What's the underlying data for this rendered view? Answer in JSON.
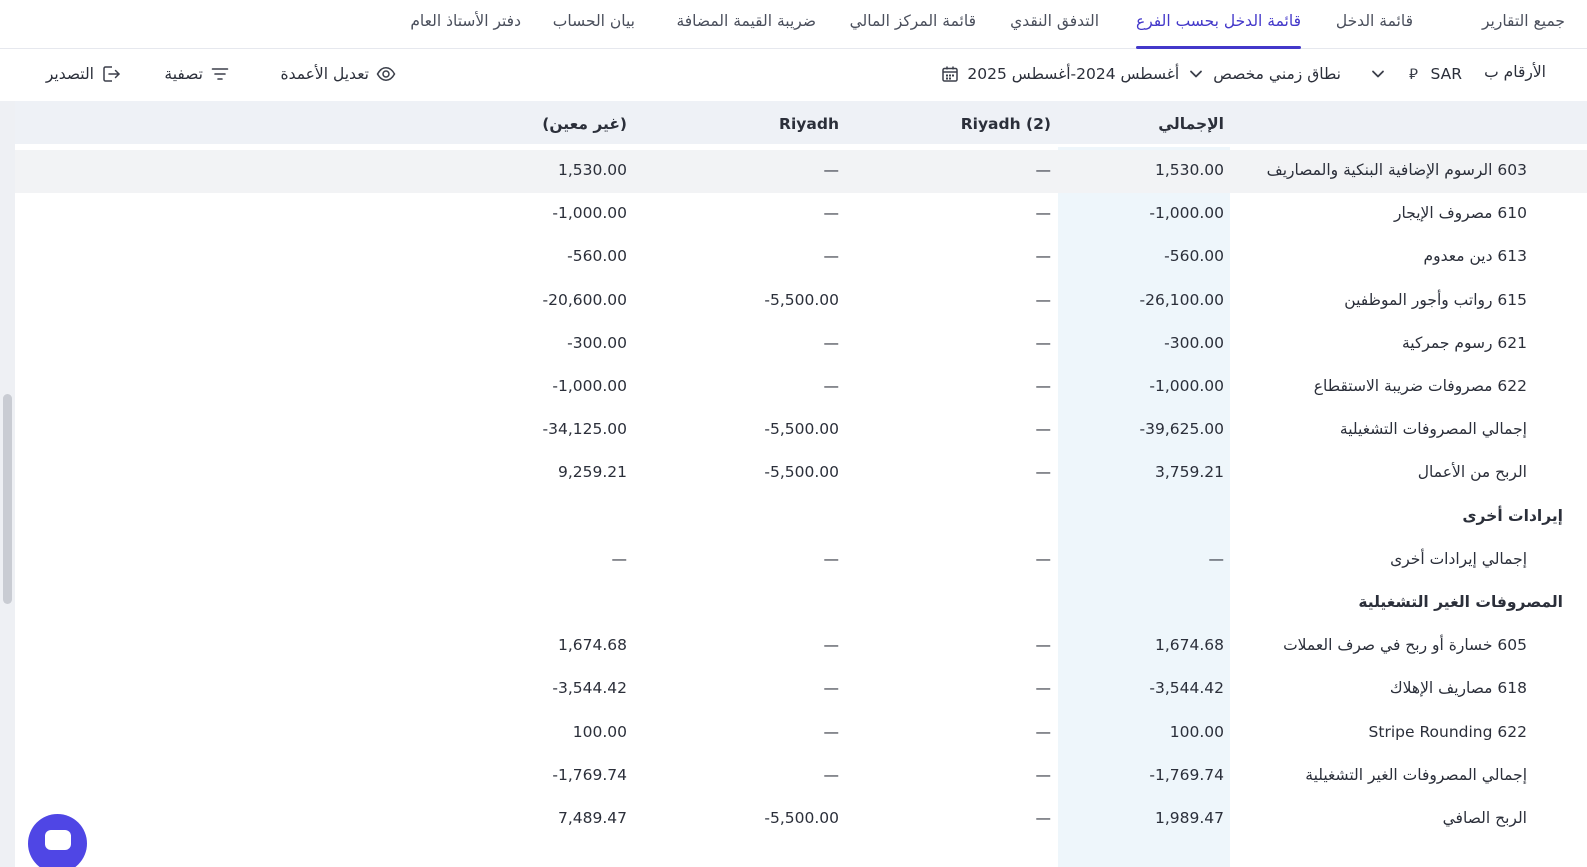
{
  "tabs": [
    {
      "label": "جميع التقارير",
      "active": false
    },
    {
      "label": "قائمة الدخل",
      "active": false
    },
    {
      "label": "قائمة الدخل بحسب الفرع",
      "active": true
    },
    {
      "label": "التدفق النقدي",
      "active": false
    },
    {
      "label": "قائمة المركز المالي",
      "active": false
    },
    {
      "label": "ضريبة القيمة المضافة",
      "active": false
    },
    {
      "label": "بيان الحساب",
      "active": false
    },
    {
      "label": "دفتر الأستاذ العام",
      "active": false
    }
  ],
  "toolbar": {
    "figures_label": "الأرقام ب",
    "currency": "SAR",
    "currency_symbol": "⃁",
    "range_type": "نطاق زمني مخصص",
    "date_range": "أغسطس 2024-أغسطس 2025",
    "edit_columns": "تعديل الأعمدة",
    "filter": "تصفية",
    "export": "التصدير"
  },
  "table": {
    "headers": [
      "",
      "الإجمالي",
      "Riyadh (2)",
      "Riyadh",
      "(غير معين)"
    ],
    "rows": [
      {
        "type": "item",
        "label": "603 الرسوم الإضافية البنكية والمصاريف",
        "values": [
          "1,530.00",
          "—",
          "—",
          "1,530.00"
        ],
        "highlight": true
      },
      {
        "type": "item",
        "label": "610 مصروف الإيجار",
        "values": [
          "-1,000.00",
          "—",
          "—",
          "-1,000.00"
        ]
      },
      {
        "type": "item",
        "label": "613 دين معدوم",
        "values": [
          "-560.00",
          "—",
          "—",
          "-560.00"
        ]
      },
      {
        "type": "item",
        "label": "615 رواتب وأجور الموظفين",
        "values": [
          "-26,100.00",
          "—",
          "-5,500.00",
          "-20,600.00"
        ]
      },
      {
        "type": "item",
        "label": "621 رسوم جمركية",
        "values": [
          "-300.00",
          "—",
          "—",
          "-300.00"
        ]
      },
      {
        "type": "item",
        "label": "622 مصروفات ضريبة الاستقطاع",
        "values": [
          "-1,000.00",
          "—",
          "—",
          "-1,000.00"
        ]
      },
      {
        "type": "item",
        "label": "إجمالي المصروفات التشغيلية",
        "values": [
          "-39,625.00",
          "—",
          "-5,500.00",
          "-34,125.00"
        ]
      },
      {
        "type": "item",
        "label": "الربح من الأعمال",
        "values": [
          "3,759.21",
          "—",
          "-5,500.00",
          "9,259.21"
        ]
      },
      {
        "type": "section",
        "label": "إيرادات أخرى"
      },
      {
        "type": "item",
        "label": "إجمالي إيرادات أخرى",
        "values": [
          "—",
          "—",
          "—",
          "—"
        ]
      },
      {
        "type": "section",
        "label": "المصروفات الغير التشغيلية"
      },
      {
        "type": "item",
        "label": "605 خسارة أو ربح في صرف العملات",
        "values": [
          "1,674.68",
          "—",
          "—",
          "1,674.68"
        ]
      },
      {
        "type": "item",
        "label": "618 مصاريف الإهلاك",
        "values": [
          "-3,544.42",
          "—",
          "—",
          "-3,544.42"
        ]
      },
      {
        "type": "item",
        "label": "622 Stripe Rounding",
        "values": [
          "100.00",
          "—",
          "—",
          "100.00"
        ]
      },
      {
        "type": "item",
        "label": "إجمالي المصروفات الغير التشغيلية",
        "values": [
          "-1,769.74",
          "—",
          "—",
          "-1,769.74"
        ]
      },
      {
        "type": "item",
        "label": "الربح الصافي",
        "values": [
          "1,989.47",
          "—",
          "-5,500.00",
          "7,489.47"
        ]
      }
    ]
  },
  "colors": {
    "accent": "#4338ca",
    "total_column_bg": "#eef6fb",
    "header_bg": "#eef1f6",
    "chat_button": "#4f46e5"
  },
  "icons": {
    "currency": "riyal-sign-icon",
    "currency_dropdown": "chevron-down-icon",
    "range_dropdown": "chevron-down-icon",
    "date": "calendar-icon",
    "columns": "eye-icon",
    "filter": "filter-icon",
    "export": "export-icon",
    "chat": "chat-icon"
  }
}
